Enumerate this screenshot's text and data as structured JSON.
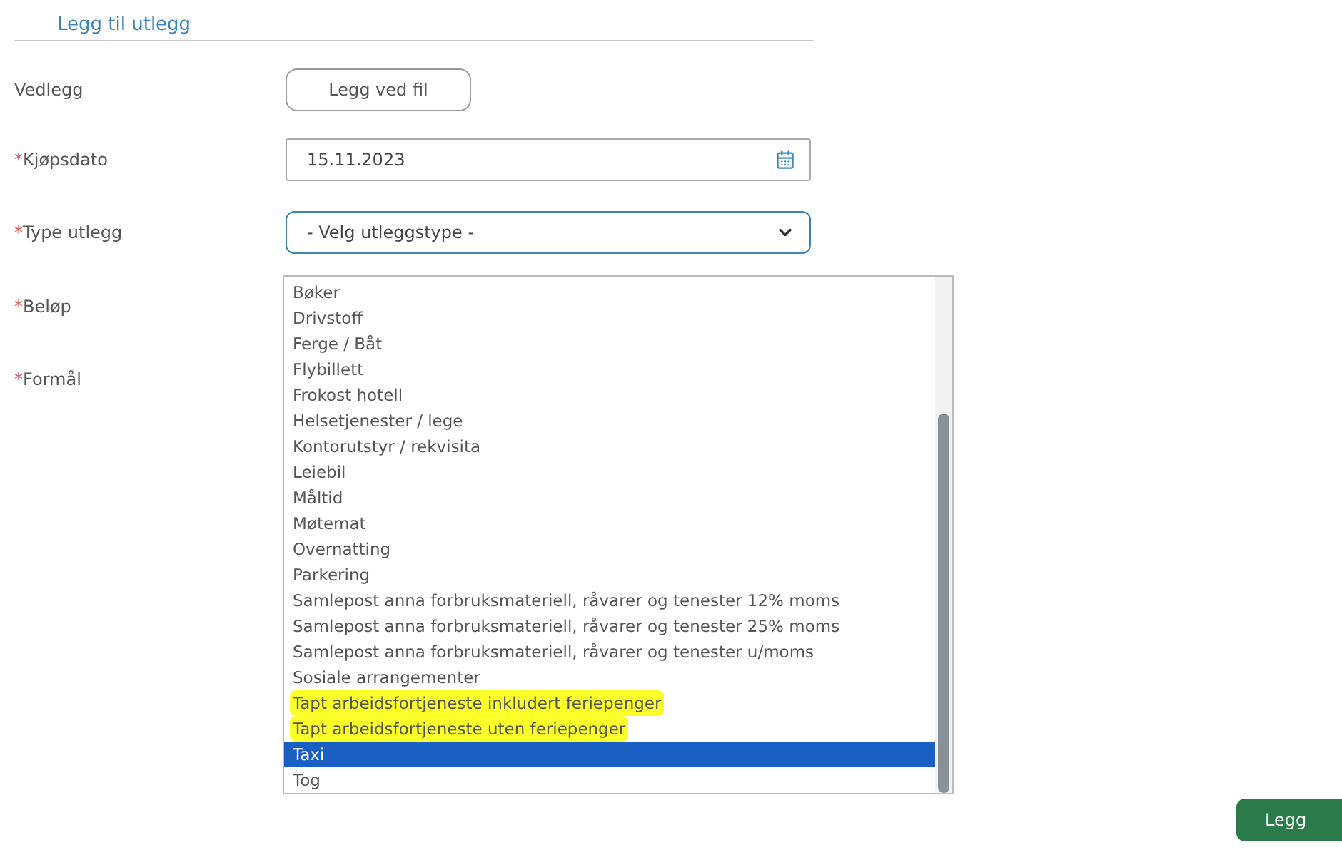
{
  "section_title": "Legg til utlegg",
  "fields": [
    {
      "kind": "file",
      "label": "Vedlegg",
      "button": "Legg ved fil"
    },
    {
      "kind": "date",
      "marker": "*",
      "label": "Kjøpsdato",
      "value": "15.11.2023"
    },
    {
      "kind": "select",
      "marker": "*",
      "label": "Type utlegg",
      "value": "- Velg utleggstype -"
    },
    {
      "kind": "plain",
      "marker": "*",
      "label": "Beløp"
    },
    {
      "kind": "plain",
      "marker": "*",
      "label": "Formål"
    }
  ],
  "dropdown_options": [
    {
      "label": "Bøker",
      "selected": false,
      "highlighted": false
    },
    {
      "label": "Drivstoff",
      "selected": false,
      "highlighted": false
    },
    {
      "label": "Ferge / Båt",
      "selected": false,
      "highlighted": false
    },
    {
      "label": "Flybillett",
      "selected": false,
      "highlighted": false
    },
    {
      "label": "Frokost hotell",
      "selected": false,
      "highlighted": false
    },
    {
      "label": "Helsetjenester / lege",
      "selected": false,
      "highlighted": false
    },
    {
      "label": "Kontorutstyr / rekvisita",
      "selected": false,
      "highlighted": false
    },
    {
      "label": "Leiebil",
      "selected": false,
      "highlighted": false
    },
    {
      "label": "Måltid",
      "selected": false,
      "highlighted": false
    },
    {
      "label": "Møtemat",
      "selected": false,
      "highlighted": false
    },
    {
      "label": "Overnatting",
      "selected": false,
      "highlighted": false
    },
    {
      "label": "Parkering",
      "selected": false,
      "highlighted": false
    },
    {
      "label": "Samlepost anna forbruksmateriell, råvarer og tenester 12% moms",
      "selected": false,
      "highlighted": false
    },
    {
      "label": "Samlepost anna forbruksmateriell, råvarer og tenester 25% moms",
      "selected": false,
      "highlighted": false
    },
    {
      "label": "Samlepost anna forbruksmateriell, råvarer og tenester u/moms",
      "selected": false,
      "highlighted": false
    },
    {
      "label": "Sosiale arrangementer",
      "selected": false,
      "highlighted": false
    },
    {
      "label": "Tapt arbeidsfortjeneste inkludert feriepenger",
      "selected": false,
      "highlighted": true
    },
    {
      "label": "Tapt arbeidsfortjeneste uten feriepenger",
      "selected": false,
      "highlighted": true
    },
    {
      "label": "Taxi",
      "selected": true,
      "highlighted": false
    },
    {
      "label": "Tog",
      "selected": false,
      "highlighted": false
    }
  ],
  "submit_button": "Legg"
}
